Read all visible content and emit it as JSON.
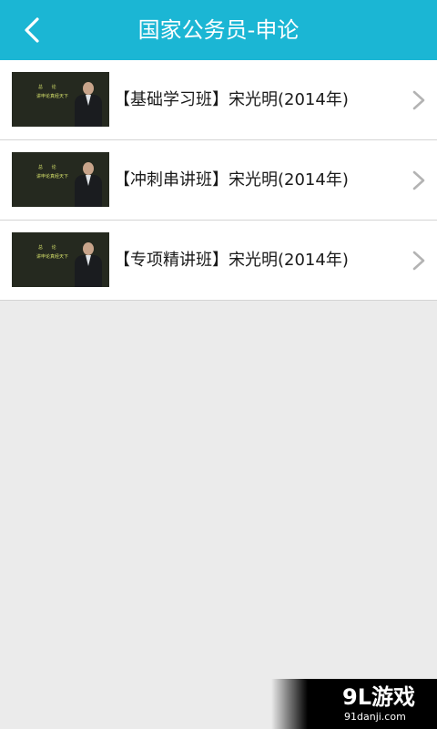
{
  "header": {
    "title": "国家公务员-申论",
    "background_color": "#1bb6d4",
    "back_icon": "chevron-left-icon"
  },
  "list": {
    "items": [
      {
        "label": "【基础学习班】宋光明(2014年)",
        "thumb_title": "总 论",
        "thumb_subtitle": "讲申论真经天下"
      },
      {
        "label": "【冲刺串讲班】宋光明(2014年)",
        "thumb_title": "总 论",
        "thumb_subtitle": "讲申论真经天下"
      },
      {
        "label": "【专项精讲班】宋光明(2014年)",
        "thumb_title": "总 论",
        "thumb_subtitle": "讲申论真经天下"
      }
    ],
    "chevron_icon": "chevron-right-icon"
  },
  "watermark": {
    "logo": "9L游戏",
    "url": "91danji.com"
  }
}
